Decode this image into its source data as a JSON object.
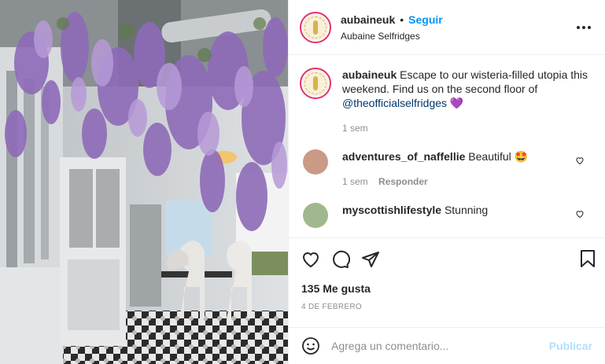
{
  "post": {
    "username": "aubaineuk",
    "separator": "•",
    "follow_label": "Seguir",
    "location": "Aubaine Selfridges",
    "more_icon": "more-options-icon"
  },
  "caption": {
    "username": "aubaineuk",
    "text": "Escape to our wisteria-filled utopia this weekend. Find us on the second floor of",
    "mention": "@theofficialselfridges",
    "emoji": "💜",
    "time": "1 sem"
  },
  "comments": [
    {
      "username": "adventures_of_naffellie",
      "text": "Beautiful",
      "emoji": "🤩",
      "time": "1 sem",
      "reply_label": "Responder",
      "avatar_color": "#c99a86"
    },
    {
      "username": "myscottishlifestyle",
      "text": "Stunning",
      "avatar_color": "#9fb88e"
    }
  ],
  "actions": {
    "likes": "135 Me gusta",
    "date": "4 DE FEBRERO"
  },
  "add_comment": {
    "placeholder": "Agrega un comentario...",
    "publish_label": "Publicar"
  },
  "colors": {
    "accent": "#0095f6",
    "publish_disabled": "#b2dffc",
    "wisteria": "#8e6bb8"
  }
}
